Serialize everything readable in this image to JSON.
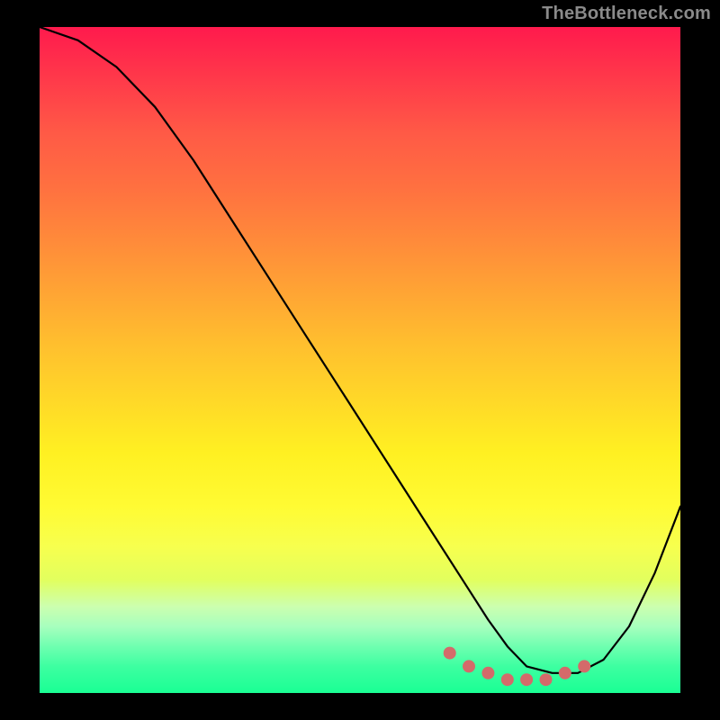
{
  "watermark": "TheBottleneck.com",
  "colors": {
    "frame": "#000000",
    "curve": "#000000",
    "marker": "#d46a6a"
  },
  "chart_data": {
    "type": "line",
    "title": "",
    "xlabel": "",
    "ylabel": "",
    "xlim": [
      0,
      100
    ],
    "ylim": [
      0,
      100
    ],
    "grid": false,
    "series": [
      {
        "name": "bottleneck-curve",
        "x": [
          0,
          6,
          12,
          18,
          24,
          30,
          36,
          42,
          48,
          54,
          60,
          66,
          70,
          73,
          76,
          80,
          84,
          88,
          92,
          96,
          100
        ],
        "values": [
          100,
          98,
          94,
          88,
          80,
          71,
          62,
          53,
          44,
          35,
          26,
          17,
          11,
          7,
          4,
          3,
          3,
          5,
          10,
          18,
          28
        ]
      }
    ],
    "markers": {
      "name": "optimal-range",
      "x": [
        64,
        67,
        70,
        73,
        76,
        79,
        82,
        85
      ],
      "values": [
        6,
        4,
        3,
        2,
        2,
        2,
        3,
        4
      ]
    }
  }
}
